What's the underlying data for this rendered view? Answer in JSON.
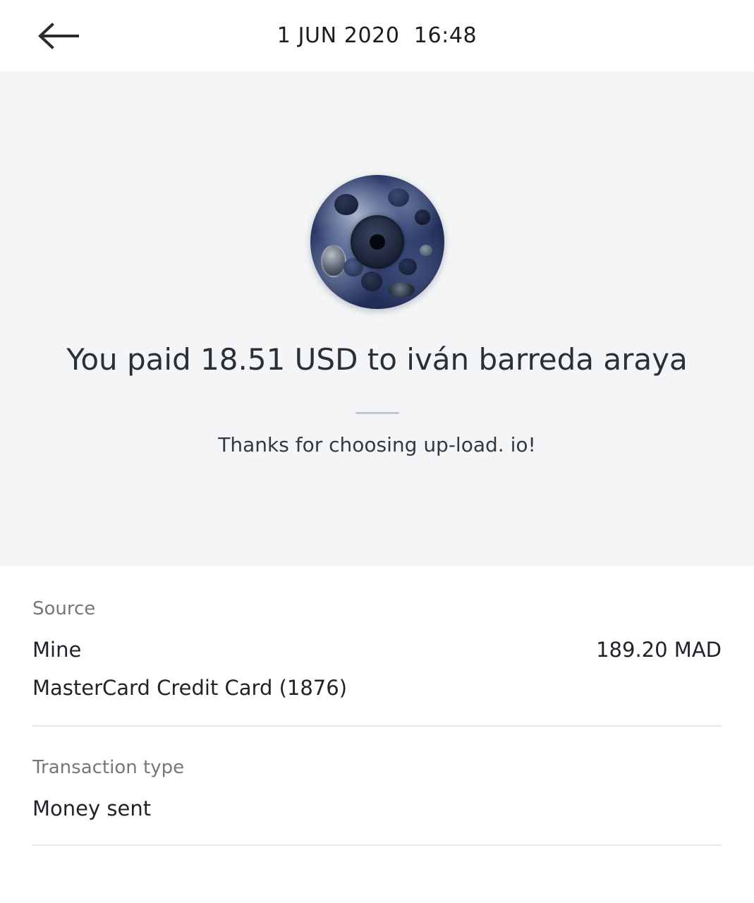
{
  "header": {
    "back_icon": "arrow-left-icon",
    "title": "1 JUN 2020  16:48"
  },
  "hero": {
    "avatar_icon": "recipient-avatar",
    "title": "You paid 18.51 USD to iván barreda araya",
    "note": "Thanks for choosing up-load. io!",
    "background_color": "#f4f5f7",
    "divider_color": "#c2c7cd"
  },
  "details": [
    {
      "label": "Source",
      "value": "Mine",
      "amount": "189.20 MAD",
      "sub_value": "MasterCard Credit Card (1876)"
    },
    {
      "label": "Transaction type",
      "value": "Money sent",
      "amount": "",
      "sub_value": ""
    }
  ],
  "colors": {
    "text_primary": "#20242a",
    "text_secondary": "#73787d",
    "divider": "#e6e7e9",
    "page_background": "#ffffff"
  }
}
